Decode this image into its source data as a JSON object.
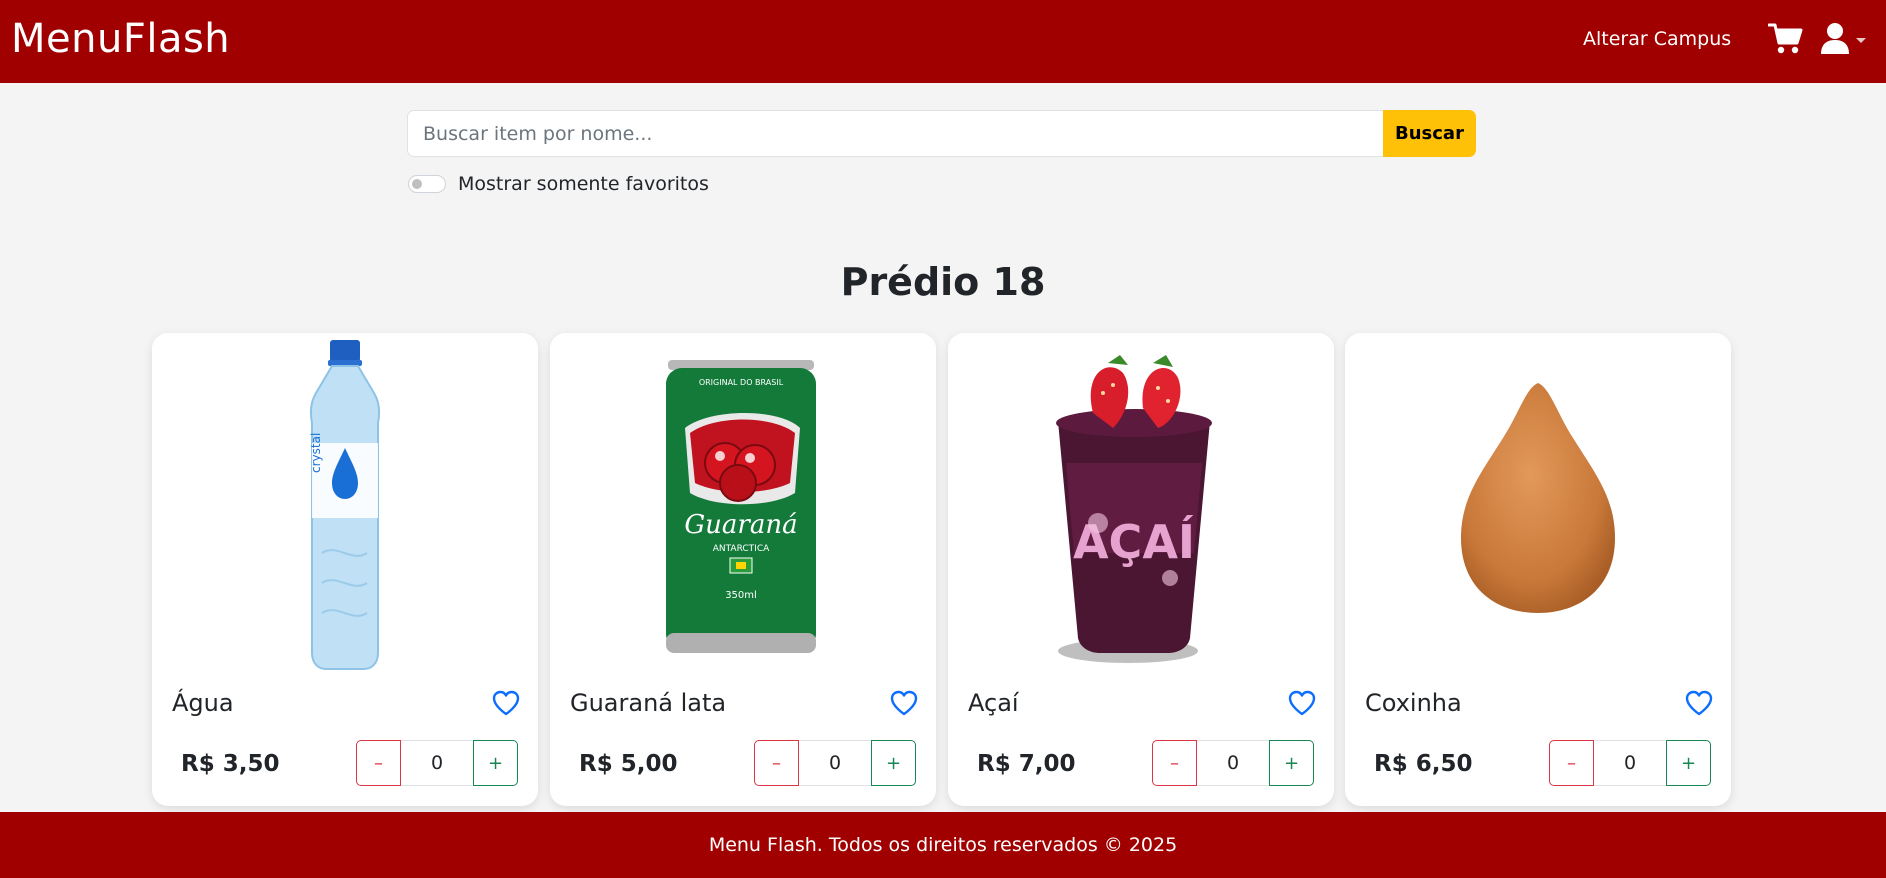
{
  "navbar": {
    "brand": "MenuFlash",
    "change_campus": "Alterar Campus",
    "cart_icon": "cart-icon",
    "user_icon": "user-icon"
  },
  "search": {
    "placeholder": "Buscar item por nome...",
    "value": "",
    "button_label": "Buscar"
  },
  "favorites_toggle": {
    "label": "Mostrar somente favoritos",
    "checked": false
  },
  "section": {
    "title": "Prédio 18"
  },
  "products": [
    {
      "name": "Água",
      "price": "R$ 3,50",
      "quantity": "0",
      "image": "water-bottle"
    },
    {
      "name": "Guaraná lata",
      "price": "R$ 5,00",
      "quantity": "0",
      "image": "guarana-can"
    },
    {
      "name": "Açaí",
      "price": "R$ 7,00",
      "quantity": "0",
      "image": "acai-cup"
    },
    {
      "name": "Coxinha",
      "price": "R$ 6,50",
      "quantity": "0",
      "image": "coxinha"
    }
  ],
  "quantity_controls": {
    "minus": "–",
    "plus": "+"
  },
  "footer": {
    "text": "Menu Flash. Todos os direitos reservados © 2025"
  },
  "colors": {
    "brand_red": "#a10000",
    "search_button": "#ffc107",
    "favorite_heart": "#0d6efd",
    "minus_border": "#dc3545",
    "plus_border": "#198754"
  }
}
